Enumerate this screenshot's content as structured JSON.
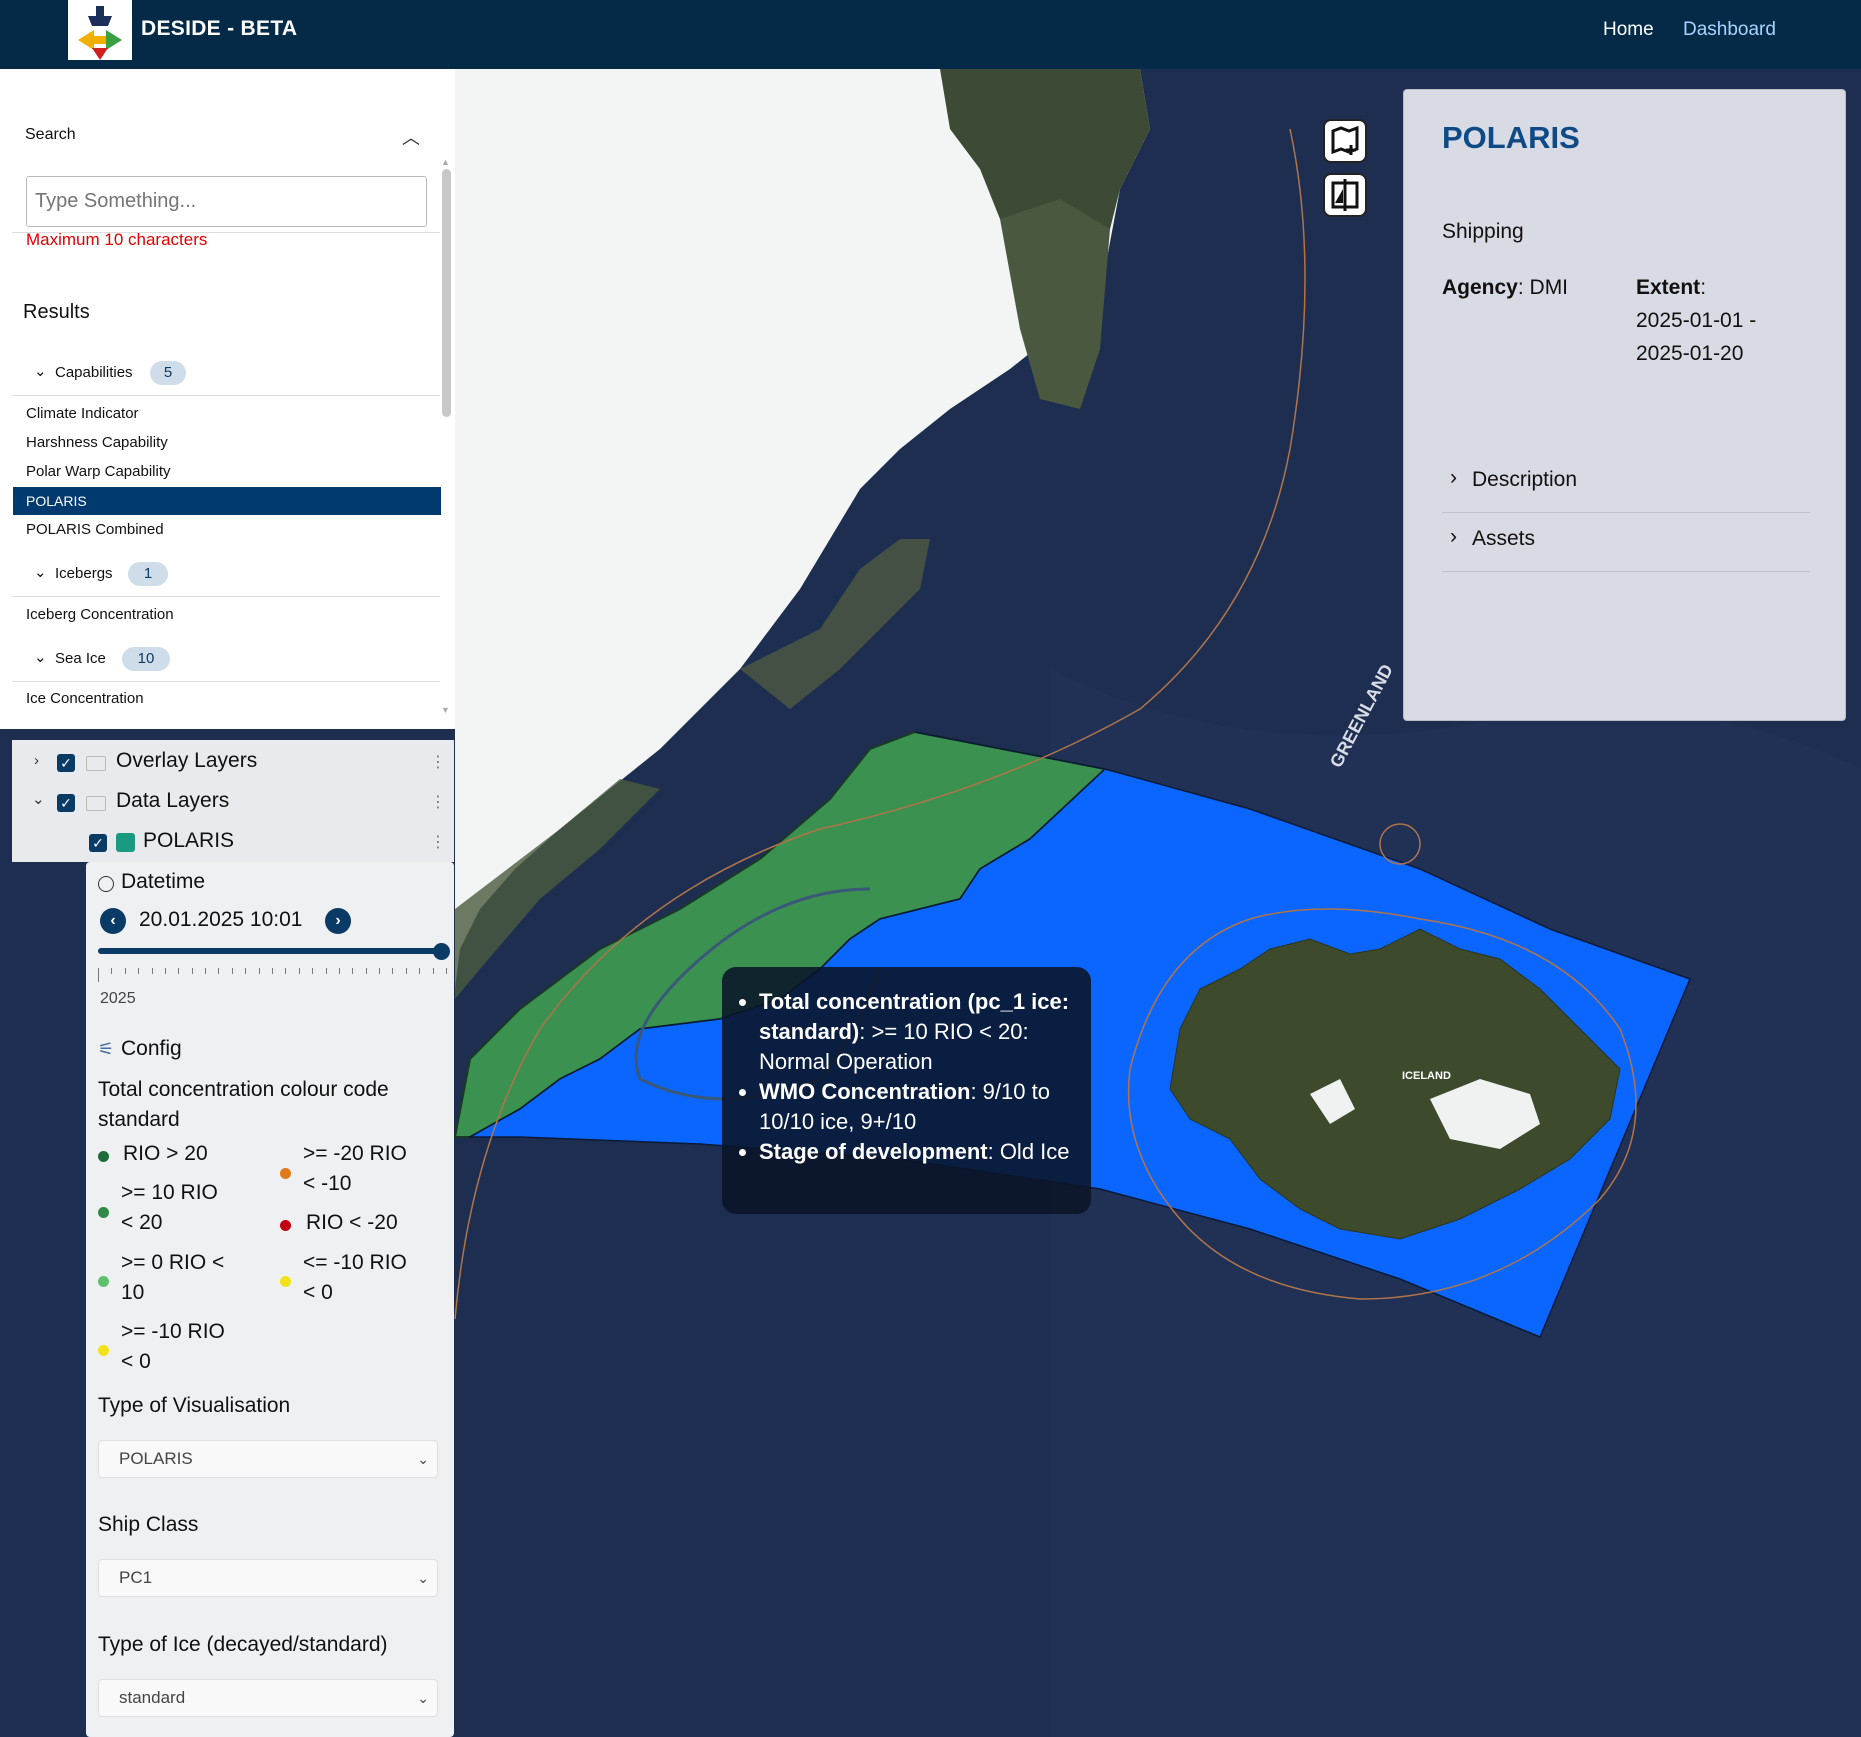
{
  "topbar": {
    "brand": "DESIDE - BETA",
    "nav": {
      "home": "Home",
      "dashboard": "Dashboard"
    }
  },
  "search": {
    "title": "Search",
    "placeholder": "Type Something...",
    "error": "Maximum 10 characters",
    "results_title": "Results",
    "groups": [
      {
        "label": "Capabilities",
        "count": "5",
        "items": [
          "Climate Indicator",
          "Harshness Capability",
          "Polar Warp Capability",
          "POLARIS",
          "POLARIS Combined"
        ]
      },
      {
        "label": "Icebergs",
        "count": "1",
        "items": [
          "Iceberg Concentration"
        ]
      },
      {
        "label": "Sea Ice",
        "count": "10",
        "items": [
          "Ice Concentration"
        ]
      }
    ],
    "selected_item": "POLARIS"
  },
  "layers": {
    "overlay": "Overlay Layers",
    "data": "Data Layers",
    "polaris": "POLARIS"
  },
  "config": {
    "datetime_label": "Datetime",
    "datetime_value": "20.01.2025 10:01",
    "year_label": "2025",
    "slider_position": 1.0,
    "config_label": "Config",
    "colour_code_title": "Total concentration colour code standard",
    "legend": [
      {
        "line1": "RIO > 20",
        "line2": "",
        "color": "#1f6a3a"
      },
      {
        "line1": ">= -20 RIO",
        "line2": "< -10",
        "color": "#e07a1a"
      },
      {
        "line1": ">= 10 RIO",
        "line2": "< 20",
        "color": "#2f8a4a"
      },
      {
        "line1": "RIO < -20",
        "line2": "",
        "color": "#c00010"
      },
      {
        "line1": ">= 0 RIO <",
        "line2": "10",
        "color": "#5fbf6a"
      },
      {
        "line1": "<= -10 RIO",
        "line2": "< 0",
        "color": "#f2e21a"
      },
      {
        "line1": ">= -10 RIO",
        "line2": "< 0",
        "color": "#f2e21a"
      }
    ],
    "vis_label": "Type of Visualisation",
    "vis_value": "POLARIS",
    "ship_label": "Ship Class",
    "ship_value": "PC1",
    "ice_label": "Type of Ice (decayed/standard)",
    "ice_value": "standard"
  },
  "info": {
    "title": "POLARIS",
    "category": "Shipping",
    "agency_label": "Agency",
    "agency_value": ": DMI",
    "extent_label": "Extent",
    "extent_colon": ":",
    "extent_from": "2025-01-01 -",
    "extent_to": "2025-01-20",
    "description": "Description",
    "assets": "Assets"
  },
  "tooltip": {
    "items": [
      {
        "bold": "Total concentration (pc_1 ice: standard)",
        "text": ": >= 10 RIO < 20: Normal Operation"
      },
      {
        "bold": "WMO Concentration",
        "text": ": 9/10 to 10/10 ice, 9+/10"
      },
      {
        "bold": "Stage of development",
        "text": ": Old Ice"
      }
    ]
  },
  "map": {
    "labels": {
      "greenland": "GREENLAND",
      "iceland": "ICELAND"
    },
    "colors": {
      "ocean": "#1d2d4f",
      "polygon_blue": "#0a66ff",
      "polygon_green": "#3a9150",
      "land_dark": "#3b4a2e",
      "snow": "#f4f5f5",
      "boundary": "#b0744a"
    }
  }
}
